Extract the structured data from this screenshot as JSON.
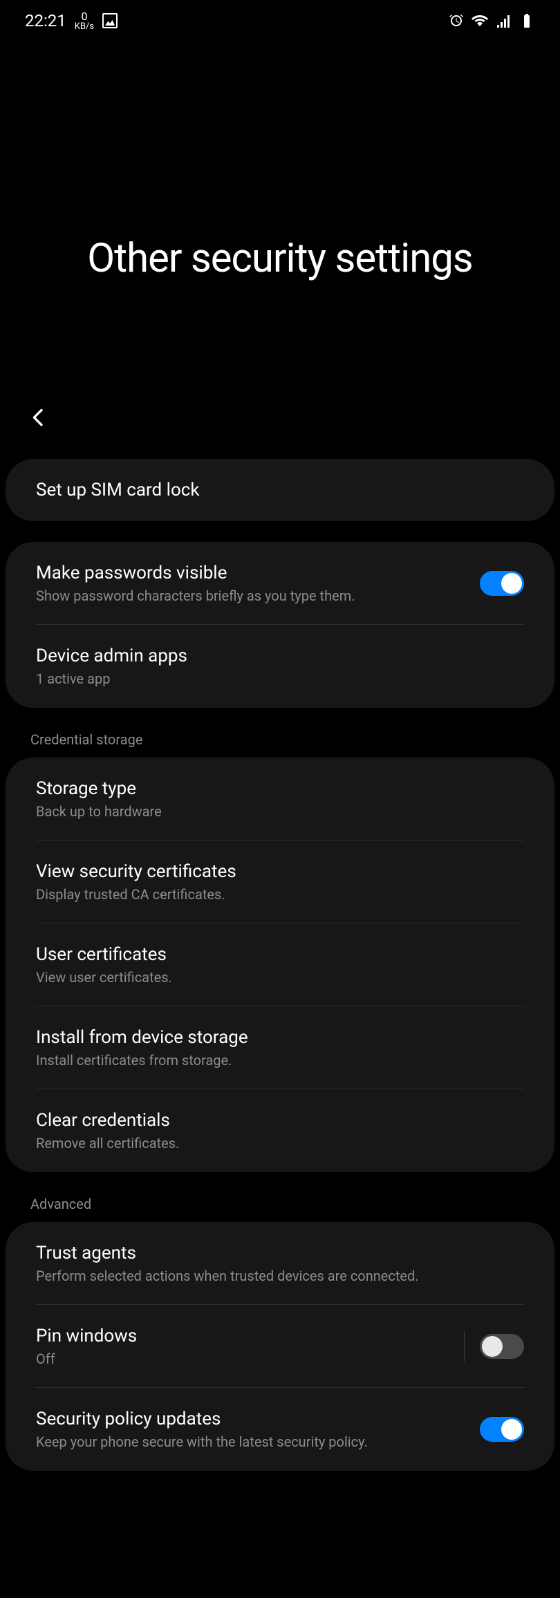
{
  "status_bar": {
    "time": "22:21",
    "speed_value": "0",
    "speed_unit": "KB/s"
  },
  "header": {
    "title": "Other security settings"
  },
  "cards": {
    "sim_lock": "Set up SIM card lock",
    "passwords_title": "Make passwords visible",
    "passwords_sub": "Show password characters briefly as you type them.",
    "admin_title": "Device admin apps",
    "admin_sub": "1 active app"
  },
  "sections": {
    "credential": "Credential storage",
    "advanced": "Advanced"
  },
  "credential_items": {
    "storage_title": "Storage type",
    "storage_sub": "Back up to hardware",
    "security_cert_title": "View security certificates",
    "security_cert_sub": "Display trusted CA certificates.",
    "user_cert_title": "User certificates",
    "user_cert_sub": "View user certificates.",
    "install_title": "Install from device storage",
    "install_sub": "Install certificates from storage.",
    "clear_title": "Clear credentials",
    "clear_sub": "Remove all certificates."
  },
  "advanced_items": {
    "trust_title": "Trust agents",
    "trust_sub": "Perform selected actions when trusted devices are connected.",
    "pin_title": "Pin windows",
    "pin_sub": "Off",
    "policy_title": "Security policy updates",
    "policy_sub": "Keep your phone secure with the latest security policy."
  }
}
